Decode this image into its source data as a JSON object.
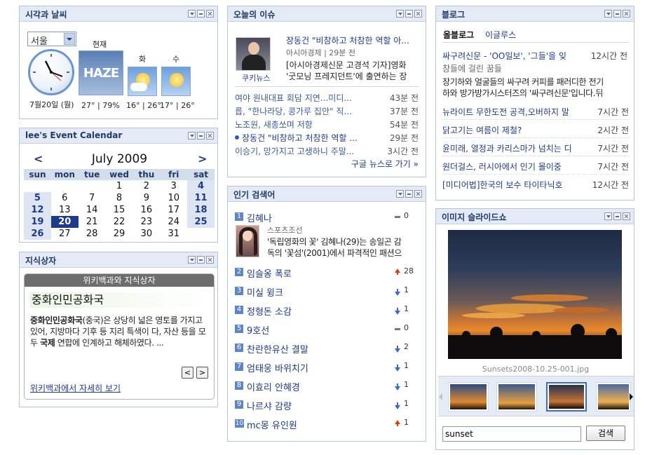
{
  "weather": {
    "title": "시각과 날씨",
    "city": "서울",
    "date": "7월20일 (월)",
    "now_label": "현재",
    "now_icon_text": "HAZE",
    "now_stat": "27° | 79%",
    "days": [
      {
        "label": "화",
        "temp": "16° | 26°"
      },
      {
        "label": "수",
        "temp": "17° | 26°"
      }
    ]
  },
  "calendar": {
    "title": "lee's Event Calendar",
    "month": "July 2009",
    "prev": "<",
    "next": ">",
    "weekdays": [
      "sun",
      "mon",
      "tue",
      "wed",
      "thu",
      "fri",
      "sat"
    ],
    "weeks": [
      [
        "",
        "",
        "",
        "1",
        "2",
        "3",
        "4"
      ],
      [
        "5",
        "6",
        "7",
        "8",
        "9",
        "10",
        "11"
      ],
      [
        "12",
        "13",
        "14",
        "15",
        "16",
        "17",
        "18"
      ],
      [
        "19",
        "20",
        "21",
        "22",
        "23",
        "24",
        "25"
      ],
      [
        "26",
        "27",
        "28",
        "29",
        "30",
        "31",
        ""
      ]
    ],
    "today": "20"
  },
  "knowledge": {
    "title": "지식상자",
    "bar": "위키백과와 지식상자",
    "heading": "중화인민공화국",
    "text_bold": "중화인민공화국",
    "text_1": "(중국)은 상당히 넓은 영토를 가지고 있어, 지방마다 기후 등 지리 특색이 다, 자산 등을 모두 ",
    "text_bold2": "국제",
    "text_2": " 연합에 인계하고 해체하였다. ...",
    "prev": "<",
    "next": ">",
    "more": "위키백과에서 자세히 보기"
  },
  "issue": {
    "title": "오늘의 이슈",
    "headline": "장동건 \"비참하고 처참한 역할 아...",
    "source": "아시아경제 | 29분 전",
    "summary_1": "[아시아경제신문 고경석 기자]영화",
    "summary_2": "'굿모닝 프레지던트'에 출연하는 장",
    "caption": "쿠키뉴스",
    "items": [
      {
        "title": "여야 원내대표 회담 지연...미디...",
        "time": "43분 전"
      },
      {
        "title": "릅, \"한나라당, 콩가루 집안\" 직...",
        "time": "37분 전"
      },
      {
        "title": "노조원, 새총쏘며 저항",
        "time": "54분 전"
      },
      {
        "title": "장동건 \"비참하고 처참한 역할 ...",
        "time": "29분 전"
      },
      {
        "title": "이승기, 망가지고 고생하니 주말...",
        "time": "3시간 전"
      }
    ],
    "more": "구글 뉴스로 가기 »"
  },
  "search": {
    "title": "인기 검색어",
    "top": {
      "word": "김혜나",
      "change": "0",
      "source": "스포츠조선",
      "text_1": "'독립영화의 꽃' 김혜나(29)는 송일곤 감",
      "text_2": "독의 '꽃섬'(2001)에서 파격적인 패션으"
    },
    "items": [
      {
        "rank": "1",
        "word": "김혜나",
        "dir": "same",
        "change": "0"
      },
      {
        "rank": "2",
        "word": "임슬옹 폭로",
        "dir": "up",
        "change": "28"
      },
      {
        "rank": "3",
        "word": "미실 윙크",
        "dir": "down",
        "change": "1"
      },
      {
        "rank": "4",
        "word": "정형돈 소감",
        "dir": "down",
        "change": "1"
      },
      {
        "rank": "5",
        "word": "9호선",
        "dir": "same",
        "change": "0"
      },
      {
        "rank": "6",
        "word": "찬란한유산 결말",
        "dir": "down",
        "change": "2"
      },
      {
        "rank": "7",
        "word": "엄태웅 바위치기",
        "dir": "down",
        "change": "1"
      },
      {
        "rank": "8",
        "word": "이효리 안혜경",
        "dir": "down",
        "change": "1"
      },
      {
        "rank": "9",
        "word": "나르샤 감량",
        "dir": "down",
        "change": "1"
      },
      {
        "rank": "10",
        "word": "mc몽 유인원",
        "dir": "up",
        "change": "1"
      }
    ]
  },
  "blog": {
    "title": "블로그",
    "tabs": [
      "올블로그",
      "이글루스"
    ],
    "top": {
      "title": "싸구려신문 - 'OO일보', '그들'을 잊",
      "time": "12시간 전",
      "title_2": "창들에 걸린 꿈들",
      "text_1": "장기하와 얼굴들의 싸구려 커피를 패러디한 전기",
      "text_2": "하와 방가방가시스터즈의 '싸구려신문'입니다.뒤"
    },
    "items": [
      {
        "title": "뉴라이트 무한도전 공격,오버하지 말",
        "time": "7시간 전"
      },
      {
        "title": "닭고기는 여름이 제철?",
        "time": "2시간 전"
      },
      {
        "title": "윤미래, 열정과 카리스마가 넘치는 디",
        "time": "7시간 전"
      },
      {
        "title": "원더걸스, 러시아에서 인기 몰이중",
        "time": "7시간 전"
      },
      {
        "title": "[미디어법]한국의 보수 타이타닉호",
        "time": "12시간 전"
      }
    ]
  },
  "slideshow": {
    "title": "이미지 슬라이드쇼",
    "caption": "Sunsets2008-10.25-001.jpg",
    "query": "sunset",
    "search_button": "검색"
  },
  "colors": {
    "header_bg": "#e4ebf6",
    "border": "#b9c4d4",
    "link": "#1f3a8a",
    "today": "#1f3a8a",
    "rank_up": "#d4400f",
    "rank_down": "#3a6cc4"
  }
}
